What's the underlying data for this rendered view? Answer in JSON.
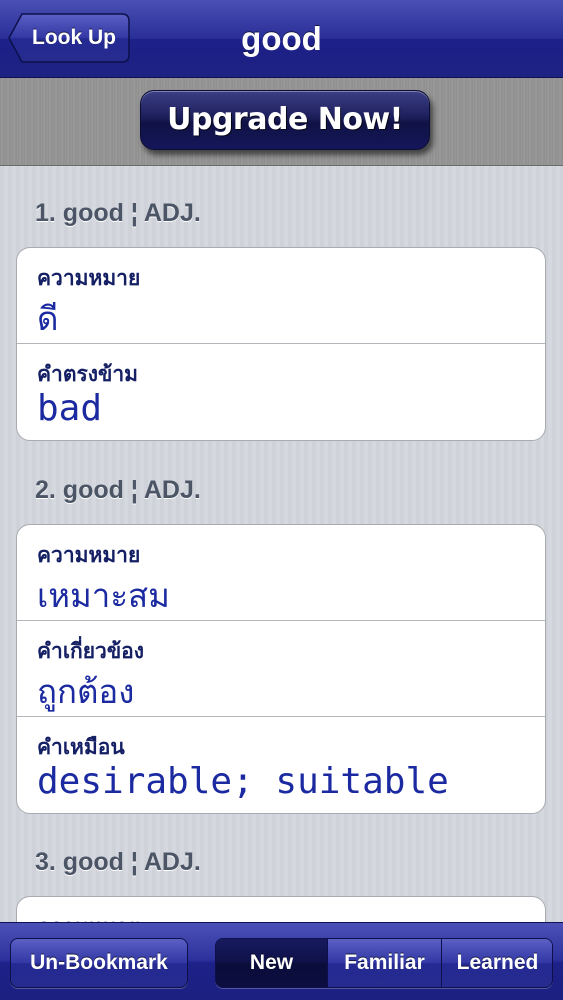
{
  "navbar": {
    "back_label": "Look Up",
    "title": "good"
  },
  "banner": {
    "upgrade_label": "Upgrade Now!"
  },
  "entries": [
    {
      "header": "1. good ¦ ADJ.",
      "rows": [
        {
          "label": "ความหมาย",
          "value": "ดี"
        },
        {
          "label": "คำตรงข้าม",
          "value": "bad"
        }
      ]
    },
    {
      "header": "2. good ¦ ADJ.",
      "rows": [
        {
          "label": "ความหมาย",
          "value": "เหมาะสม"
        },
        {
          "label": "คำเกี่ยวข้อง",
          "value": "ถูกต้อง"
        },
        {
          "label": "คำเหมือน",
          "value": "desirable; suitable"
        }
      ]
    },
    {
      "header": "3. good ¦ ADJ.",
      "rows": [
        {
          "label": "ความหมาย",
          "value": ""
        }
      ]
    }
  ],
  "toolbar": {
    "bookmark_label": "Un-Bookmark",
    "segments": [
      "New",
      "Familiar",
      "Learned"
    ],
    "selected_segment": "New"
  },
  "colors": {
    "bar_blue": "#2a2f98",
    "label_navy": "#152064",
    "value_blue": "#1b2aa0",
    "header_gray": "#4c5566"
  }
}
